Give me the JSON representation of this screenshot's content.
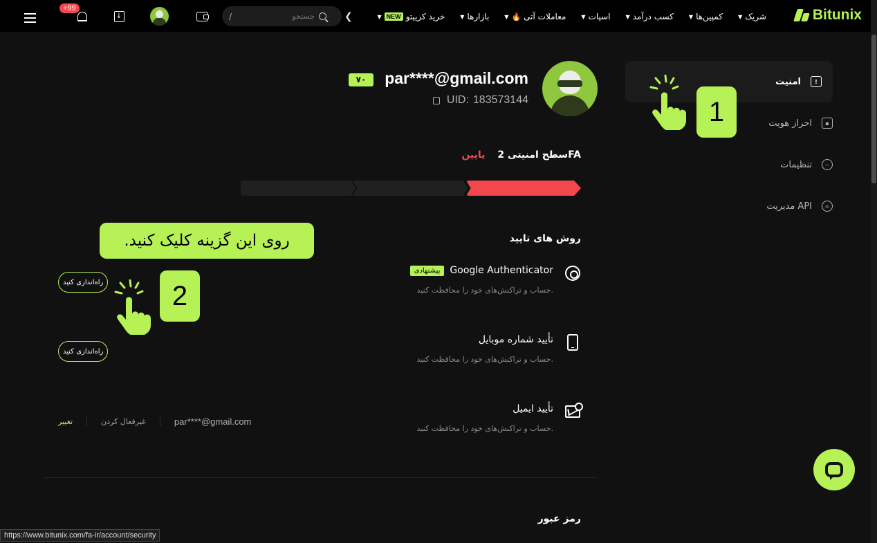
{
  "header": {
    "logo_text": "Bitunix",
    "nav": [
      {
        "label": "خرید کریپتو",
        "badge": "NEW",
        "dropdown": true
      },
      {
        "label": "بازارها",
        "dropdown": true
      },
      {
        "label": "معاملات آتی",
        "icon": "fire-icon",
        "dropdown": true
      },
      {
        "label": "اسپات",
        "dropdown": true
      },
      {
        "label": "کسب درآمد",
        "dropdown": true
      },
      {
        "label": "کمپین‌ها",
        "dropdown": true
      },
      {
        "label": "شریک",
        "dropdown": true
      }
    ],
    "search_placeholder": "جستجو",
    "search_shortcut": "/",
    "notification_count": "+99"
  },
  "sidebar": {
    "items": [
      {
        "label": "امنیت",
        "icon": "shield-icon",
        "active": true
      },
      {
        "label": "احراز هویت",
        "icon": "id-card-icon"
      },
      {
        "label": "تنظیمات",
        "icon": "settings-icon"
      },
      {
        "label": "مدیریت API",
        "icon": "link-icon"
      }
    ]
  },
  "profile": {
    "email": "par****@gmail.com",
    "vip": "۷۰",
    "uid_label": "UID:",
    "uid": "183573144"
  },
  "security": {
    "level_label": "سطح امنیتی 2FA",
    "level_value": "پایین",
    "level_fraction": 0.33,
    "colors": {
      "accent": "#b6f255",
      "low": "#f2484d"
    }
  },
  "verification": {
    "title": "روش های تایید",
    "methods": [
      {
        "title": "Google Authenticator",
        "badge": "پیشنهادی",
        "subtitle": "حساب و تراکنش‌های خود را محافظت کنید.",
        "action": "راه‌اندازی کنید",
        "icon": "authenticator-icon"
      },
      {
        "title": "تأیید شماره موبایل",
        "subtitle": "حساب و تراکنش‌های خود را محافظت کنید.",
        "action": "راه‌اندازی کنید",
        "icon": "phone-icon"
      },
      {
        "title": "تأیید ایمیل",
        "subtitle": "حساب و تراکنش‌های خود را محافظت کنید.",
        "email": "par****@gmail.com",
        "disable": "غیرفعال کردن",
        "change": "تغییر",
        "icon": "mail-icon"
      }
    ]
  },
  "password_section": {
    "title": "رمز عبور"
  },
  "tutorial": {
    "bubble_text": "روی این گزینه کلیک کنید.",
    "step1": "1",
    "step2": "2"
  },
  "status_bar": {
    "url": "https://www.bitunix.com/fa-ir/account/security"
  }
}
